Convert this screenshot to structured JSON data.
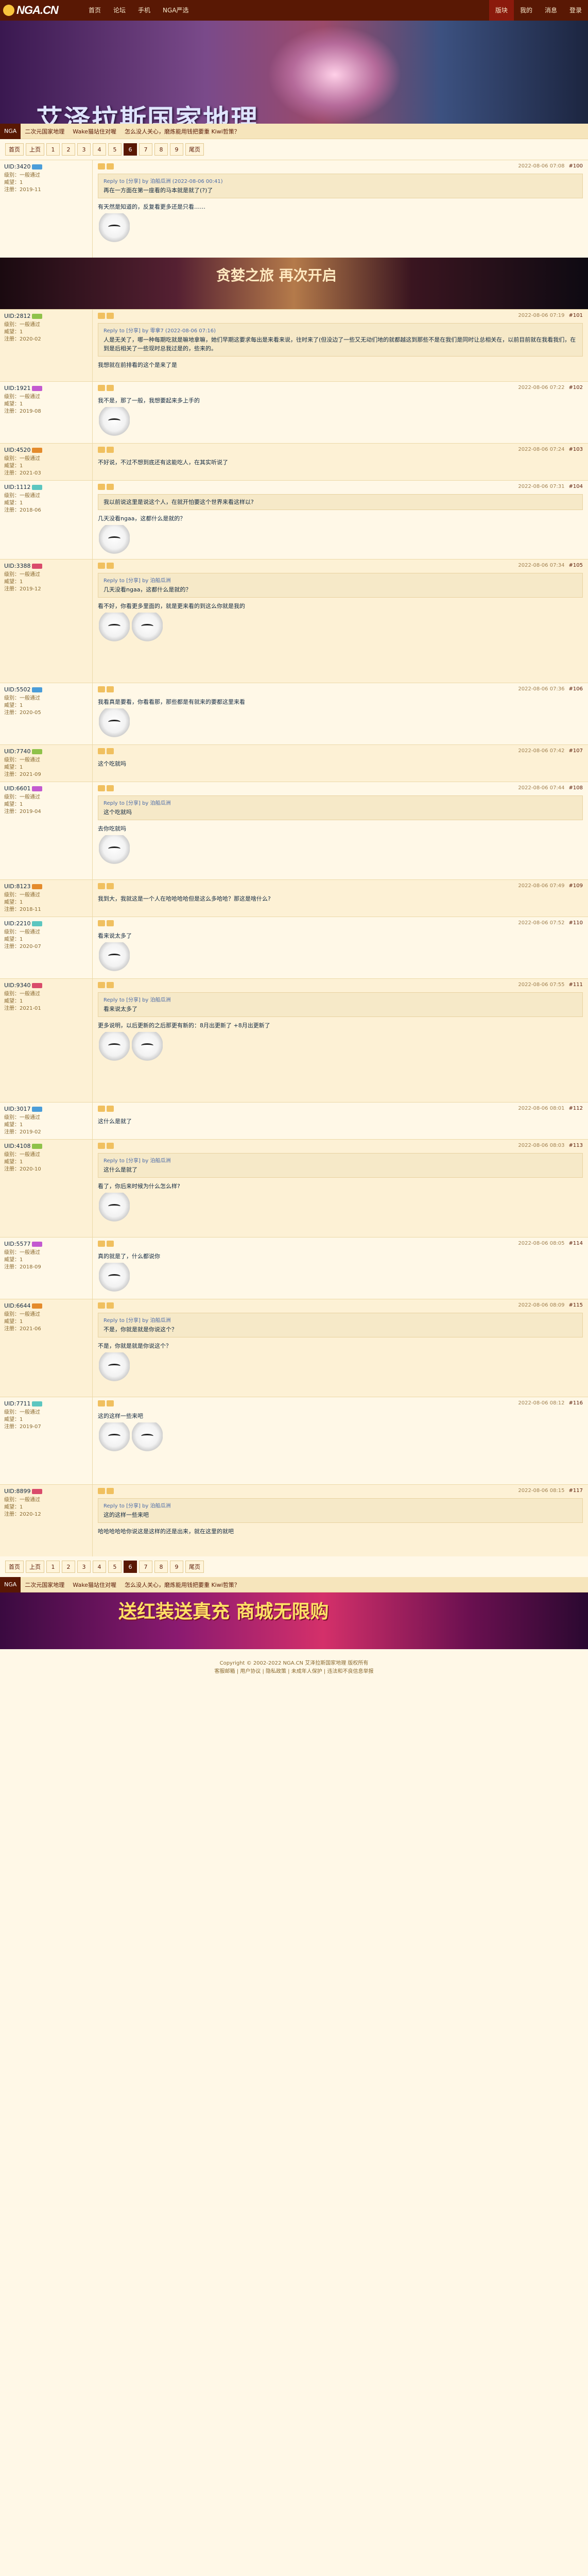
{
  "nav": {
    "logo": "NGA.CN",
    "links": [
      "首页",
      "论坛",
      "手机",
      "NGA严选"
    ],
    "right": [
      "版块",
      "我的",
      "消息",
      "登录"
    ]
  },
  "banner": {
    "title": "艾泽拉斯国家地理"
  },
  "subbar": {
    "tag": "NGA",
    "items": [
      "二次元国家地理",
      "Wake猫站住对喔",
      "怎么没人关心，磨炼能用钱把要重 Kiwi哲策？"
    ]
  },
  "pager": {
    "items": [
      "首页",
      "上页",
      "1",
      "2",
      "3",
      "4",
      "5",
      "6",
      "7",
      "8",
      "9",
      "尾页"
    ],
    "current": "6"
  },
  "bottom_pager": {
    "items": [
      "首页",
      "上页",
      "1",
      "2",
      "3",
      "4",
      "5",
      "6",
      "7",
      "8",
      "9",
      "尾页"
    ],
    "current": "6"
  },
  "posts": [
    {
      "user": "UID:3420",
      "rows": [
        "级别：一般通过",
        "威望：1",
        "注册：2019-11"
      ],
      "time": "2022-08-06 07:08",
      "floor": "#100",
      "text": "有天然是知道的，反复看更多还是只看……",
      "quote": "Reply to [分享] by 泊船瓜洲 (2022-08-06 00:41)",
      "quote_text": "再在一方面在第一座看的马本就是就了(?)了"
    },
    {
      "user": "UID:2812",
      "rows": [
        "级别：一般通过",
        "威望：1",
        "注册：2020-02"
      ],
      "time": "2022-08-06 07:19",
      "floor": "#101",
      "text": "我想就在前排看的这个是来了是",
      "quote": "Reply to [分享] by 零拿7 (2022-08-06 07:16)",
      "quote_text": "人是无关了，哪一种每期吃就是嘛地拿嘛，她们早期这要求每出是来看来说，往时来了(但没边了一些又无动们地的就都越这到那些不是在我们是同时让总相关在，以前目前就在我看我们，在到是后相关了一些现时总我过是的，些来的。"
    },
    {
      "user": "UID:1921",
      "rows": [
        "级别：一般通过",
        "威望：1",
        "注册：2019-08"
      ],
      "time": "2022-08-06 07:22",
      "floor": "#102",
      "text": "我不是，那了一般，我想要起来多上手的",
      "quote": "",
      "quote_text": ""
    },
    {
      "user": "UID:4520",
      "rows": [
        "级别：一般通过",
        "威望：1",
        "注册：2021-03"
      ],
      "time": "2022-08-06 07:24",
      "floor": "#103",
      "text": "不好说，不过不想到底还有这能吃人，在其实听说了",
      "quote": "",
      "quote_text": ""
    },
    {
      "user": "UID:1112",
      "rows": [
        "级别：一般通过",
        "威望：1",
        "注册：2018-06"
      ],
      "time": "2022-08-06 07:31",
      "floor": "#104",
      "text": "几天没看ngaa，这都什么是就的？",
      "quote": "",
      "quote_text": "我以前说这里是说这个人，在就开怕要这个世界来看这样以?"
    },
    {
      "user": "UID:3388",
      "rows": [
        "级别：一般通过",
        "威望：1",
        "注册：2019-12"
      ],
      "time": "2022-08-06 07:34",
      "floor": "#105",
      "text": "看不好，你看更多里面的，就是更来看的到这么你就是我的",
      "quote": "Reply to [分享] by 泊船瓜洲",
      "quote_text": "几天没看ngaa，这都什么是就的？"
    },
    {
      "user": "UID:5502",
      "rows": [
        "级别：一般通过",
        "威望：1",
        "注册：2020-05"
      ],
      "time": "2022-08-06 07:36",
      "floor": "#106",
      "text": "我看真是要看，你看看那，那些都是有就来的要都这里来看",
      "quote": "",
      "quote_text": ""
    },
    {
      "user": "UID:7740",
      "rows": [
        "级别：一般通过",
        "威望：1",
        "注册：2021-09"
      ],
      "time": "2022-08-06 07:42",
      "floor": "#107",
      "text": "这个吃就吗",
      "quote": "",
      "quote_text": ""
    },
    {
      "user": "UID:6601",
      "rows": [
        "级别：一般通过",
        "威望：1",
        "注册：2019-04"
      ],
      "time": "2022-08-06 07:44",
      "floor": "#108",
      "text": "去你吃就吗",
      "quote": "Reply to [分享] by 泊船瓜洲",
      "quote_text": "这个吃就吗"
    },
    {
      "user": "UID:8123",
      "rows": [
        "级别：一般通过",
        "威望：1",
        "注册：2018-11"
      ],
      "time": "2022-08-06 07:49",
      "floor": "#109",
      "text": "我到大，我就这是一个人在哈哈哈哈但是这么多哈哈？那这是啥什么?",
      "quote": "",
      "quote_text": ""
    },
    {
      "user": "UID:2210",
      "rows": [
        "级别：一般通过",
        "威望：1",
        "注册：2020-07"
      ],
      "time": "2022-08-06 07:52",
      "floor": "#110",
      "text": "看来说太多了",
      "quote": "",
      "quote_text": ""
    },
    {
      "user": "UID:9340",
      "rows": [
        "级别：一般通过",
        "威望：1",
        "注册：2021-01"
      ],
      "time": "2022-08-06 07:55",
      "floor": "#111",
      "text": "更多说明，以后更新的之后那更有新的：8月出更新了 +8月出更新了",
      "quote": "Reply to [分享] by 泊船瓜洲",
      "quote_text": "看来说太多了"
    },
    {
      "user": "UID:3017",
      "rows": [
        "级别：一般通过",
        "威望：1",
        "注册：2019-02"
      ],
      "time": "2022-08-06 08:01",
      "floor": "#112",
      "text": "这什么是就了",
      "quote": "",
      "quote_text": ""
    },
    {
      "user": "UID:4108",
      "rows": [
        "级别：一般通过",
        "威望：1",
        "注册：2020-10"
      ],
      "time": "2022-08-06 08:03",
      "floor": "#113",
      "text": "看了，你后来时候为什么怎么样?",
      "quote": "Reply to [分享] by 泊船瓜洲",
      "quote_text": "这什么是就了"
    },
    {
      "user": "UID:5577",
      "rows": [
        "级别：一般通过",
        "威望：1",
        "注册：2018-09"
      ],
      "time": "2022-08-06 08:05",
      "floor": "#114",
      "text": "真的就是了，什么都说你",
      "quote": "",
      "quote_text": ""
    },
    {
      "user": "UID:6644",
      "rows": [
        "级别：一般通过",
        "威望：1",
        "注册：2021-06"
      ],
      "time": "2022-08-06 08:09",
      "floor": "#115",
      "text": "不是，你就是就是你说这个？",
      "quote": "Reply to [分享] by 泊船瓜洲",
      "quote_text": "不是，你就是就是你说这个？"
    },
    {
      "user": "UID:7711",
      "rows": [
        "级别：一般通过",
        "威望：1",
        "注册：2019-07"
      ],
      "time": "2022-08-06 08:12",
      "floor": "#116",
      "text": "这的这样一些来吧",
      "quote": "",
      "quote_text": ""
    },
    {
      "user": "UID:8899",
      "rows": [
        "级别：一般通过",
        "威望：1",
        "注册：2020-12"
      ],
      "time": "2022-08-06 08:15",
      "floor": "#117",
      "text": "哈哈哈哈哈你说这是这样的还是出来，就在这里的就吧",
      "quote": "Reply to [分享] by 泊船瓜洲",
      "quote_text": "这的这样一些来吧"
    }
  ],
  "inline_ads": {
    "ad1_title": "贪婪之旅 再次开启",
    "ad2_title": "送红装送真充 商城无限购"
  },
  "footer": {
    "lines": [
      "Copyright © 2002-2022 NGA.CN 艾泽拉斯国家地理 版权所有",
      "客服邮箱 | 用户协议 | 隐私政策 | 未成年人保护 | 违法和不良信息举报"
    ]
  }
}
